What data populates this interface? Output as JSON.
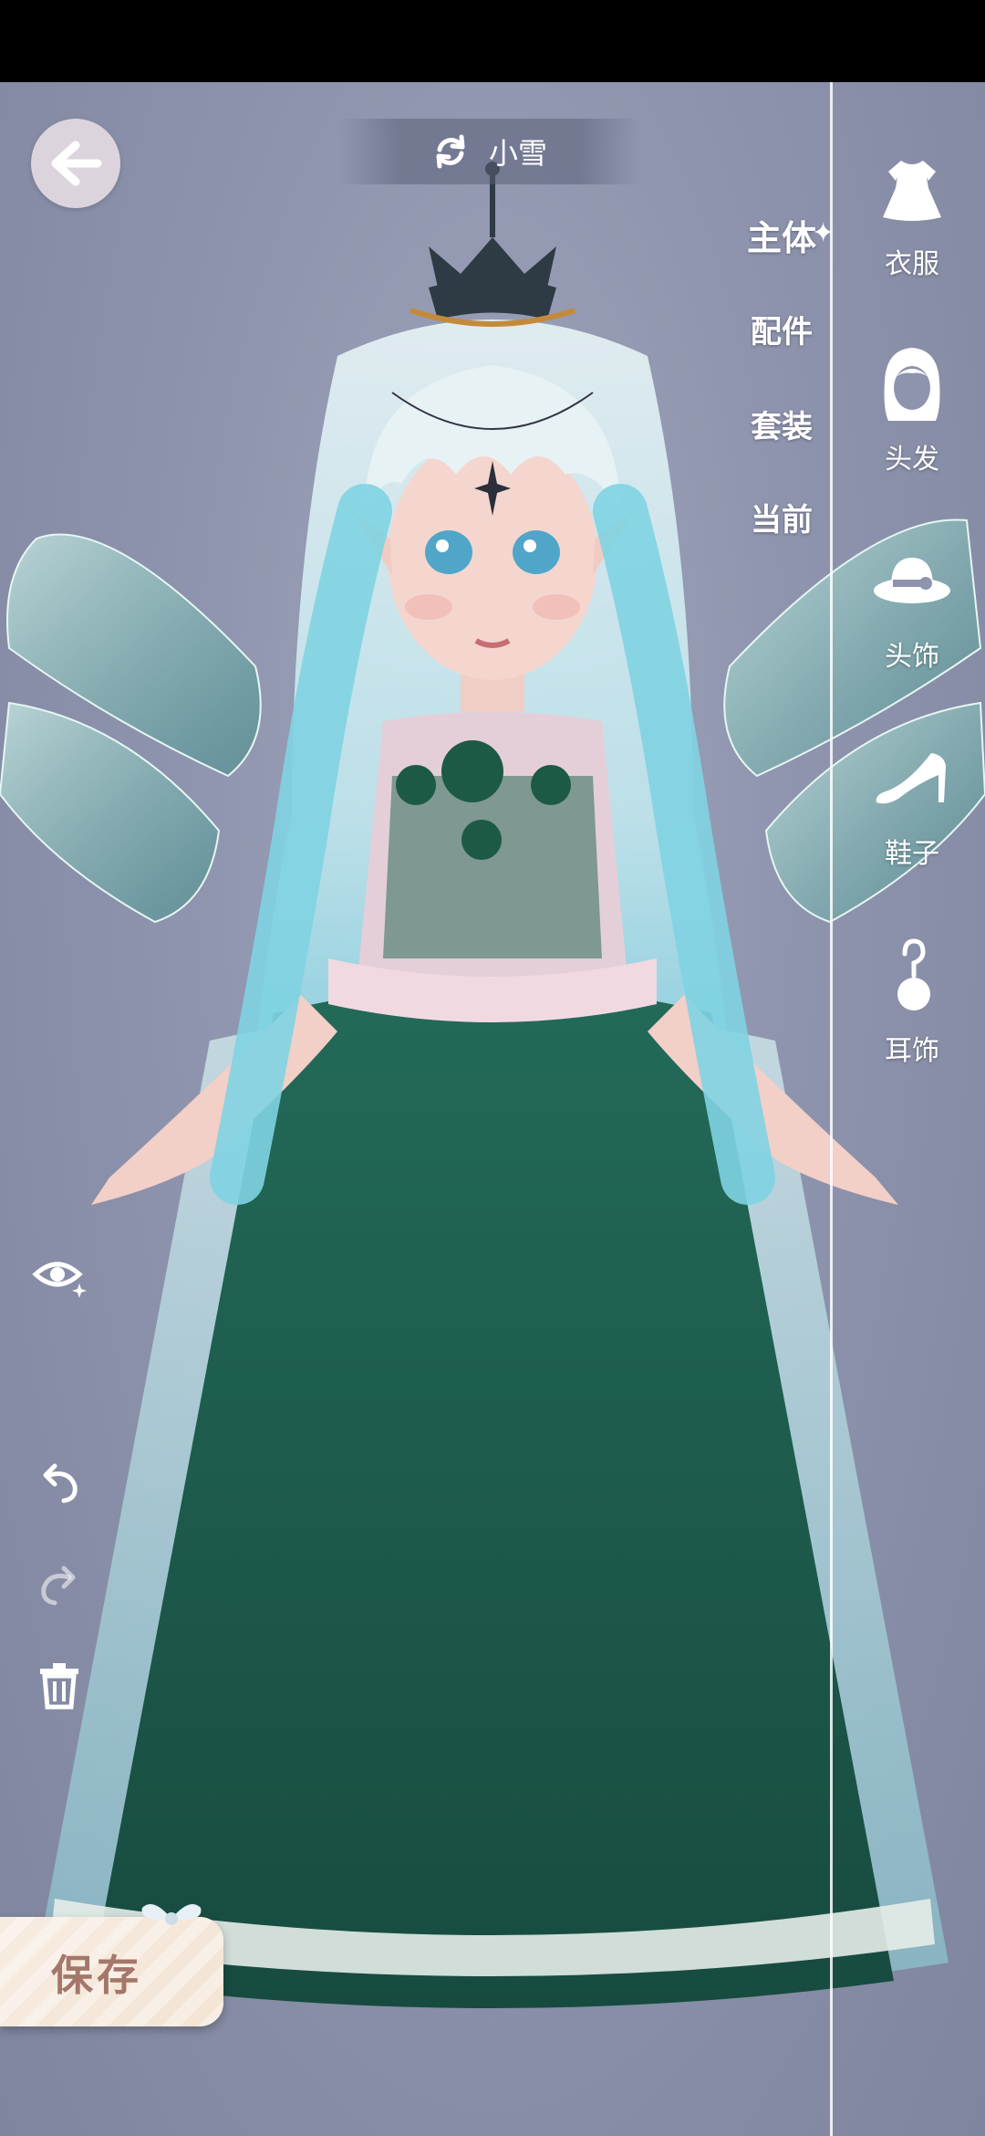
{
  "header": {
    "character_name": "小雪"
  },
  "mid_tabs": [
    {
      "label": "主体",
      "active": true
    },
    {
      "label": "配件",
      "active": false
    },
    {
      "label": "套装",
      "active": false
    },
    {
      "label": "当前",
      "active": false
    }
  ],
  "categories": [
    {
      "label": "衣服",
      "icon": "dress-icon"
    },
    {
      "label": "头发",
      "icon": "hair-icon"
    },
    {
      "label": "头饰",
      "icon": "hat-icon"
    },
    {
      "label": "鞋子",
      "icon": "high-heel-icon"
    },
    {
      "label": "耳饰",
      "icon": "earring-icon"
    }
  ],
  "tools": [
    {
      "icon": "eye-sparkle-icon"
    },
    {
      "icon": "undo-icon"
    },
    {
      "icon": "redo-icon"
    },
    {
      "icon": "trash-icon"
    }
  ],
  "save": {
    "label": "保存"
  },
  "colors": {
    "background": "#8e94ad",
    "dress_green": "#1f5a4b",
    "hair_cyan": "#58c8d8",
    "save_text": "#a4776a"
  }
}
